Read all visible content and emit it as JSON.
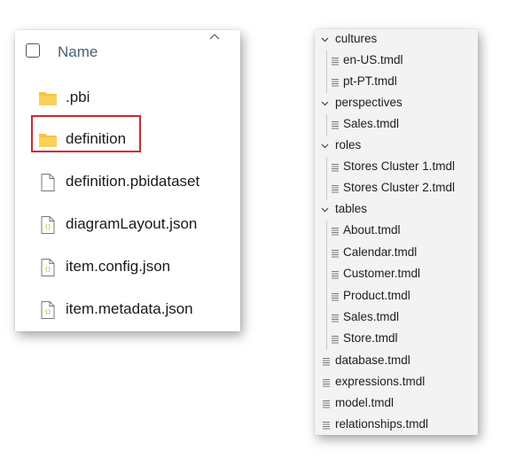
{
  "explorer": {
    "header": {
      "label": "Name"
    },
    "items": [
      {
        "label": ".pbi",
        "icon": "folder-icon"
      },
      {
        "label": "definition",
        "icon": "folder-icon",
        "highlighted": true
      },
      {
        "label": "definition.pbidataset",
        "icon": "file-icon"
      },
      {
        "label": "diagramLayout.json",
        "icon": "json-file-icon"
      },
      {
        "label": "item.config.json",
        "icon": "json-file-icon"
      },
      {
        "label": "item.metadata.json",
        "icon": "json-file-icon"
      }
    ]
  },
  "tree": {
    "folders": [
      {
        "label": "cultures",
        "children": [
          "en-US.tmdl",
          "pt-PT.tmdl"
        ]
      },
      {
        "label": "perspectives",
        "children": [
          "Sales.tmdl"
        ]
      },
      {
        "label": "roles",
        "children": [
          "Stores Cluster 1.tmdl",
          "Stores Cluster 2.tmdl"
        ]
      },
      {
        "label": "tables",
        "children": [
          "About.tmdl",
          "Calendar.tmdl",
          "Customer.tmdl",
          "Product.tmdl",
          "Sales.tmdl",
          "Store.tmdl"
        ]
      }
    ],
    "files": [
      "database.tmdl",
      "expressions.tmdl",
      "model.tmdl",
      "relationships.tmdl"
    ]
  },
  "colors": {
    "highlight_border": "#d6252e",
    "folder_yellow": "#f6c243",
    "tree_background": "#f3f3f3"
  }
}
